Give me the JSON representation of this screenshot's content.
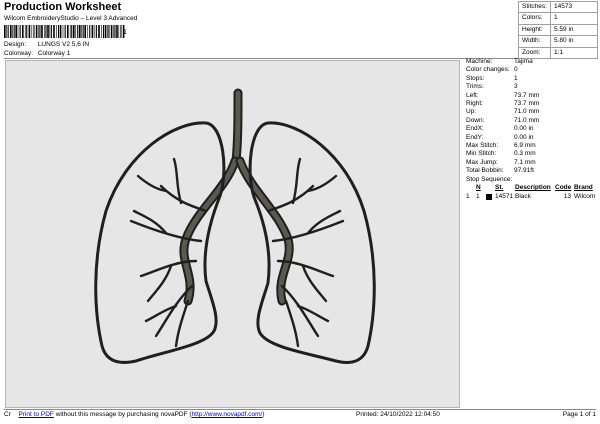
{
  "header": {
    "title": "Production Worksheet",
    "subtitle": "Wilcom EmbroideryStudio – Level 3 Advanced",
    "barcode_digit": "1",
    "design_label": "Design:",
    "design_value": "LUNGS V2 5,6 IN",
    "colorway_label": "Colorway:",
    "colorway_value": "Colorway 1"
  },
  "stats": [
    {
      "label": "Stitches:",
      "value": "14573"
    },
    {
      "label": "Colors:",
      "value": "1"
    },
    {
      "label": "Height:",
      "value": "5.59 in"
    },
    {
      "label": "Width:",
      "value": "5.80 in"
    },
    {
      "label": "Zoom:",
      "value": "1:1"
    }
  ],
  "machine_specs": [
    {
      "label": "Machine:",
      "value": "Tajima"
    },
    {
      "label": "Color changes:",
      "value": "0"
    },
    {
      "label": "Stops:",
      "value": "1"
    },
    {
      "label": "Trims:",
      "value": "3"
    },
    {
      "label": "Left:",
      "value": "73.7 mm"
    },
    {
      "label": "Right:",
      "value": "73.7 mm"
    },
    {
      "label": "Up:",
      "value": "71.0 mm"
    },
    {
      "label": "Down:",
      "value": "71.0 mm"
    },
    {
      "label": "EndX:",
      "value": "0.00 in"
    },
    {
      "label": "EndY:",
      "value": "0.00 in"
    },
    {
      "label": "Max Stitch:",
      "value": "6.9 mm"
    },
    {
      "label": "Min Stitch:",
      "value": "0.3 mm"
    },
    {
      "label": "Max Jump:",
      "value": "7.1 mm"
    },
    {
      "label": "Total Bobbin:",
      "value": "97.91ft"
    }
  ],
  "stop_sequence": {
    "title": "Stop Sequence:",
    "headers": {
      "n": "N",
      "st": "St.",
      "description": "Description",
      "code": "Code",
      "brand": "Brand"
    },
    "rows": [
      {
        "index": "1",
        "n": "1",
        "stitches": "14571",
        "description": "Black",
        "code": "13",
        "brand": "Wilcom",
        "color": "#000000"
      }
    ]
  },
  "design_colors": {
    "canvas": "#e6e6e6",
    "thread": "#1f1f1f",
    "thread_mid": "#5a5a50"
  },
  "footer": {
    "cr": "Cr",
    "print_link": "Print to PDF",
    "message": " without this message by purchasing novaPDF (",
    "url_link": "http://www.novapdf.com/",
    "close": ")",
    "printed": "Printed: 24/10/2022 12:04:50",
    "page": "Page 1 of 1"
  }
}
